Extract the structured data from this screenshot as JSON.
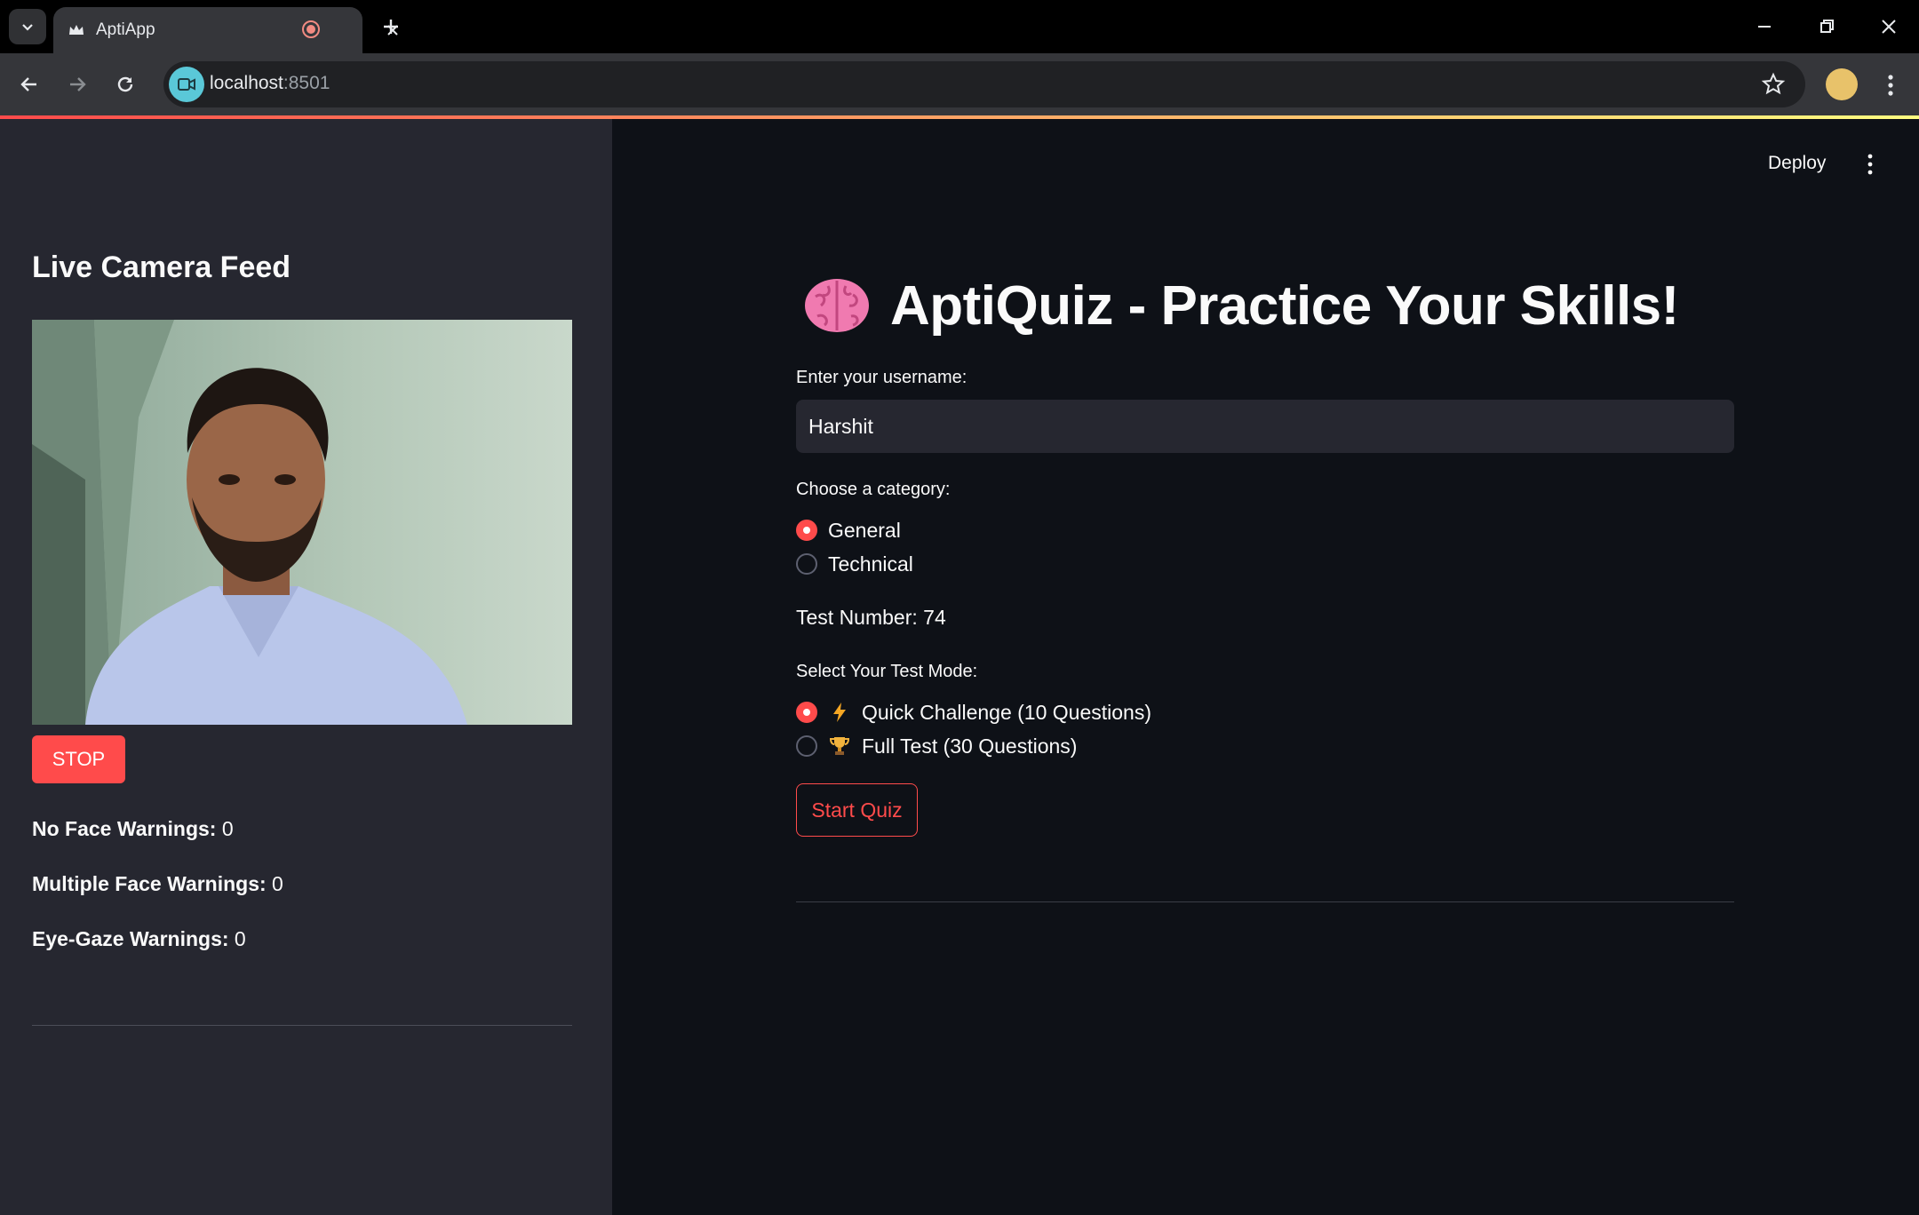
{
  "browser": {
    "tab_title": "AptiApp",
    "url_host": "localhost",
    "url_port": ":8501"
  },
  "header": {
    "deploy_label": "Deploy"
  },
  "sidebar": {
    "title": "Live Camera Feed",
    "stop_label": "STOP",
    "warnings": [
      {
        "label": "No Face Warnings:",
        "value": " 0"
      },
      {
        "label": "Multiple Face Warnings:",
        "value": " 0"
      },
      {
        "label": "Eye-Gaze Warnings:",
        "value": " 0"
      }
    ]
  },
  "main": {
    "title": "AptiQuiz - Practice Your Skills!",
    "username_label": "Enter your username:",
    "username_value": "Harshit",
    "category_label": "Choose a category:",
    "categories": [
      {
        "label": "General",
        "selected": true
      },
      {
        "label": "Technical",
        "selected": false
      }
    ],
    "test_number_text": "Test Number: 74",
    "mode_label": "Select Your Test Mode:",
    "modes": [
      {
        "icon": "lightning-icon",
        "label": "Quick Challenge (10 Questions)",
        "selected": true
      },
      {
        "icon": "trophy-icon",
        "label": "Full Test (30 Questions)",
        "selected": false
      }
    ],
    "start_label": "Start Quiz"
  },
  "colors": {
    "accent": "#ff4b4b",
    "background": "#0e1117",
    "sidebar_background": "#262730"
  }
}
